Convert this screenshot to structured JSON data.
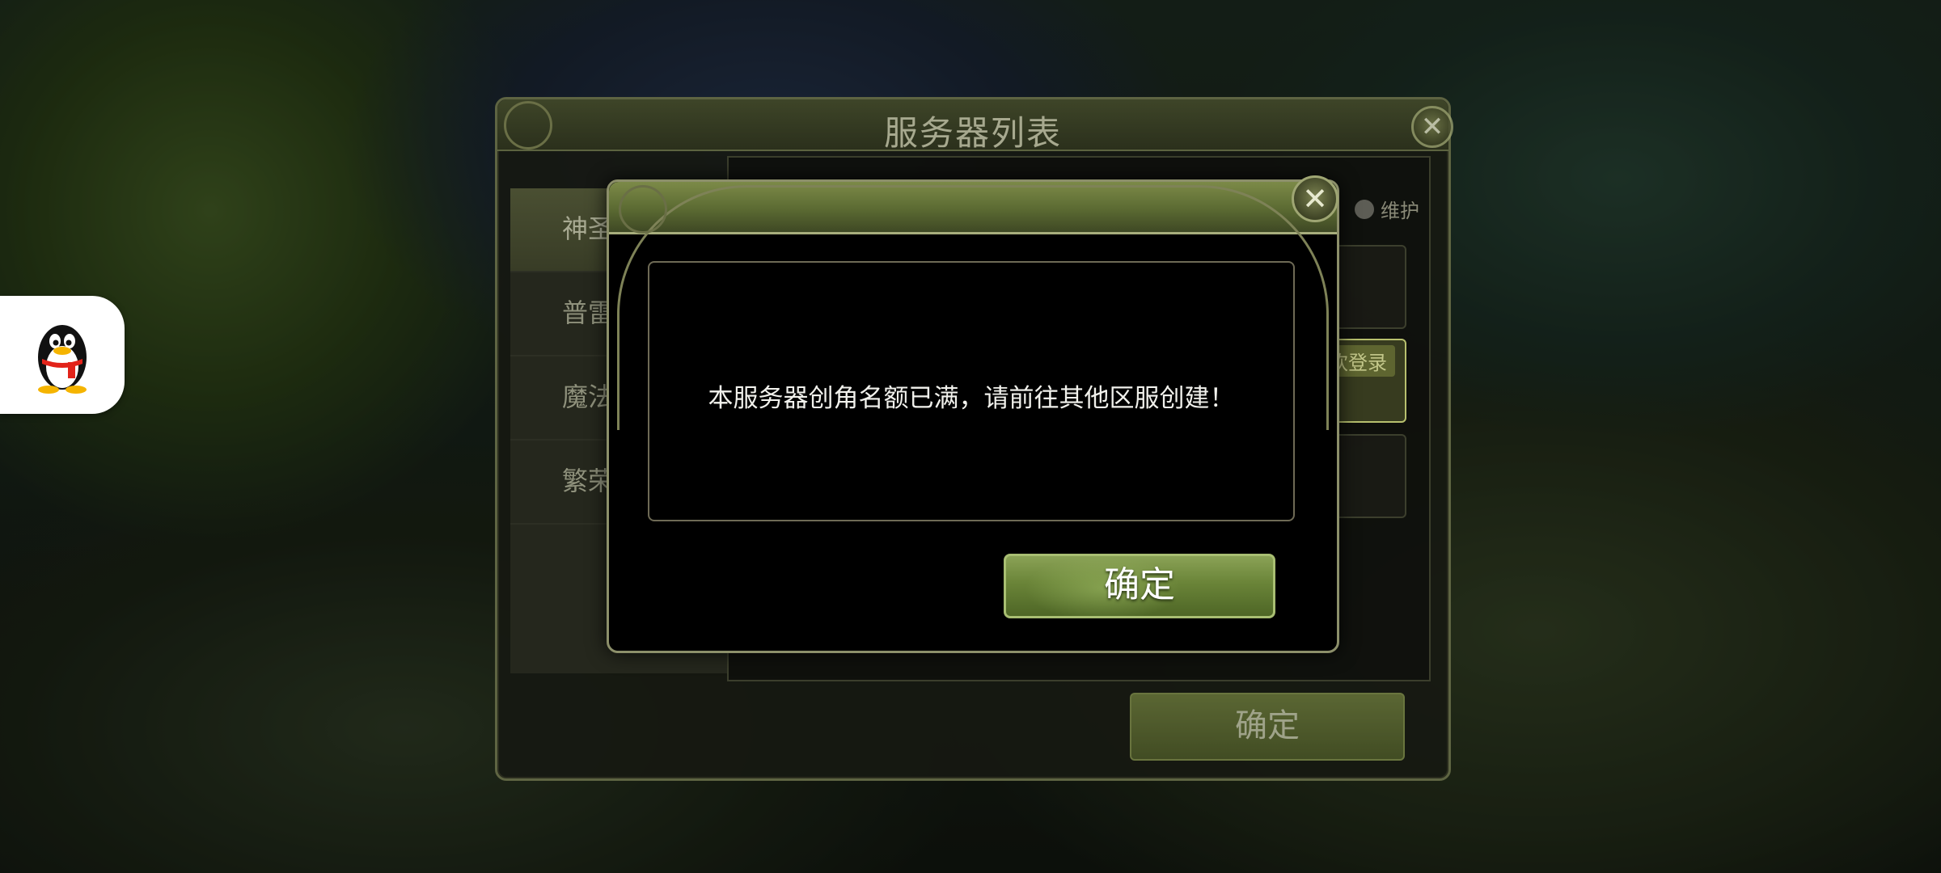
{
  "server_window": {
    "title": "服务器列表",
    "close_glyph": "✕",
    "regions": [
      "神圣",
      "普雷利",
      "魔法山",
      "繁荣之"
    ],
    "status_label": "维护",
    "row_tag": "欢登录",
    "confirm_label": "确定"
  },
  "dialog": {
    "close_glyph": "✕",
    "message": "本服务器创角名额已满，请前往其他区服创建！",
    "confirm_label": "确定"
  },
  "qq_widget": {
    "icon": "qq-penguin-icon"
  },
  "colors": {
    "accent_green": "#6a8438",
    "frame_gold": "#8c8f6a",
    "text_white": "#f1f1ec"
  }
}
